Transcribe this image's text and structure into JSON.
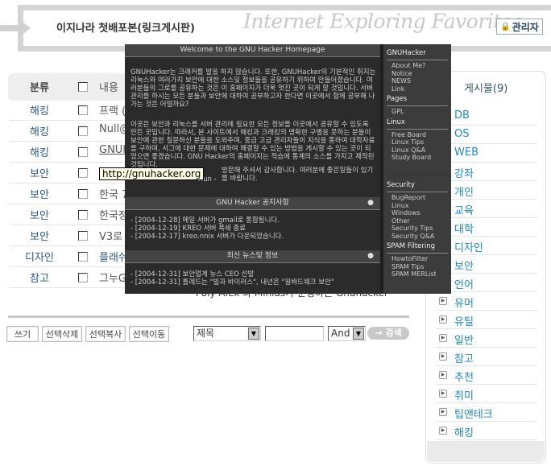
{
  "header": {
    "title": "이지나라 첫배포본(링크게시판)",
    "watermark": "Internet Exploring Favorites",
    "admin_label": "관리자"
  },
  "table": {
    "col_category": "분류",
    "col_content": "내용",
    "rows": [
      {
        "category": "해킹",
        "content": "프랙 ("
      },
      {
        "category": "해킹",
        "content": "Null@"
      },
      {
        "category": "해킹",
        "content": "GNUh"
      },
      {
        "category": "보안",
        "content": ""
      },
      {
        "category": "보안",
        "content": "한국 7"
      },
      {
        "category": "보안",
        "content": "한국정"
      },
      {
        "category": "보안",
        "content": "V3로 -"
      },
      {
        "category": "디자인",
        "content": "플래쉬"
      },
      {
        "category": "참고",
        "content": "그누G"
      }
    ]
  },
  "tooltip": "http://gnuhacker.org",
  "preview": {
    "main_title": "Welcome to the GNU Hacker Homepage",
    "intro1": "GNUHacker는 크래커를 발을 하지 않습니다. 또한, GNUHacker의 기본적인 취지는 리눅스와 여러가지 보안에 대한 소스및 정보들을 공유하기 위하여 만들어졌습니다. 여러분들의 그로를 공유하는 것은 이 홈페이지가 더욱 멋진 곳이 되게 할 것입니다. 서버 관리를 하시는 모든 분들과 보안에 대하여 공부하고자 한다면 이곳에서 함께 공부해 나가는 것은 어떨까요?",
    "intro2": "이곳은 보안과 리눅스를 서버 관리에 필요한 모든 정보를 이곳에서 공유할 수 있도록 만든 곳입니다. 따라서, 본 사이트에서 해킹과 크래킹의 명확한 구별을 못하는 분들이 보안에 관한 질문하신 분들을 도와주며, 중급 고급 관리자들이 지식을 통하여 대학자료를 구하여, 서그에 대한 문제에 대하여 해결할 수 있는 방법을 게시할 수 있는 곳이 되었으면 좋겠습니다. GNU Hacker의 홈페이지는 적습에 통계의 소스를 가지고 제작된 것입니다.",
    "intro3": "방문해 주셔서 감사합니다. 여러분에 좋은일들이 있기를 바랍니다.",
    "intro4": "- Hun -",
    "notice_title": "GNU Hacker 공지사항",
    "notices": [
      "- [2004-12-28] 메일 서버가 gmail로 통합됩니다.",
      "- [2004-12-19] KREO 서버 폭쇄 종료",
      "- [2004-12-17] kreo.nnix 서버가 다운되었습니다."
    ],
    "news_title": "최신 뉴스및 정보",
    "news": [
      "- [2004-12-31] 보안업계 뉴스 CEO 선발",
      "- [2004-12-31] 틀레드는 \"빌과 바이러스\", 내년은 \"웜바드웨크 보안\""
    ],
    "side": [
      {
        "head": "GNUHacker",
        "items": [
          "About Me?",
          "Notice",
          "NEWS",
          "Link"
        ]
      },
      {
        "head": "Pages",
        "items": [
          "GPL"
        ]
      },
      {
        "head": "Linux",
        "items": [
          "Free Board",
          "Linux Tips",
          "Linux Q&A",
          "Study Board"
        ]
      }
    ],
    "side2": [
      {
        "head": "Security",
        "items": [
          "BugReport",
          "Linux",
          "Windows",
          "Other",
          "Security Tips",
          "Security Q&A"
        ]
      },
      {
        "head": "SPAM Filtering",
        "items": [
          "HowtoFilter",
          "SPAM Tips",
          "SPAM MERList"
        ]
      }
    ],
    "footer": "Poly Alex 와 Minias가 운영하는 Gnuhacker"
  },
  "toolbar": {
    "write": "쓰기",
    "delete_sel": "선택삭제",
    "copy_sel": "선택복사",
    "move_sel": "선택이동",
    "field": "제목",
    "search_value": "",
    "op": "And",
    "search": "검색"
  },
  "sidebar": {
    "title": "게시물(9)",
    "items": [
      "DB",
      "OS",
      "WEB",
      "강좌",
      "개인",
      "교육",
      "대학",
      "디자인",
      "보안",
      "언어",
      "유머",
      "유틸",
      "일반",
      "참고",
      "추천",
      "취미",
      "팁앤테크",
      "해킹"
    ]
  }
}
